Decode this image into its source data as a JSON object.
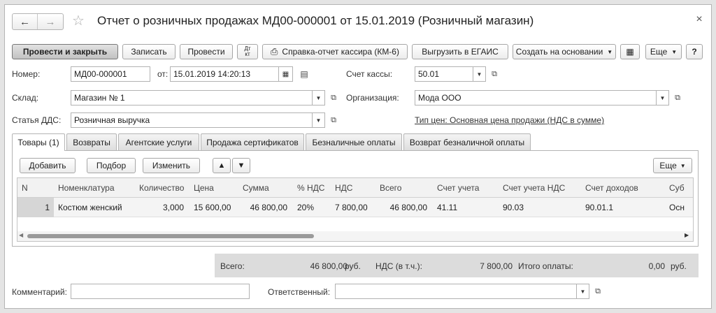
{
  "window": {
    "title": "Отчет о розничных продажах МД00-000001 от 15.01.2019 (Розничный магазин)",
    "close_icon": "close-icon"
  },
  "nav": {
    "back_icon": "arrow-left-icon",
    "forward_icon": "arrow-right-icon",
    "favorite_icon": "star-icon"
  },
  "toolbar": {
    "post_and_close": "Провести и закрыть",
    "save": "Записать",
    "post": "Провести",
    "dt_kt_top": "Дт",
    "dt_kt_bottom": "кт",
    "cashier_report": "Справка-отчет кассира (КМ-6)",
    "export_egais": "Выгрузить в ЕГАИС",
    "create_based_on": "Создать на основании",
    "more": "Еще",
    "help": "?"
  },
  "form": {
    "number_label": "Номер:",
    "number_value": "МД00-000001",
    "date_label": "от:",
    "date_value": "15.01.2019 14:20:13",
    "cash_account_label": "Счет кассы:",
    "cash_account_value": "50.01",
    "warehouse_label": "Склад:",
    "warehouse_value": "Магазин № 1",
    "organization_label": "Организация:",
    "organization_value": "Мода ООО",
    "dds_label": "Статья ДДС:",
    "dds_value": "Розничная выручка",
    "price_type_link": "Тип цен: Основная цена продажи (НДС в сумме)"
  },
  "tabs": [
    "Товары (1)",
    "Возвраты",
    "Агентские услуги",
    "Продажа сертификатов",
    "Безналичные оплаты",
    "Возврат безналичной оплаты"
  ],
  "table_toolbar": {
    "add": "Добавить",
    "select": "Подбор",
    "edit": "Изменить",
    "more": "Еще"
  },
  "table": {
    "columns": [
      "N",
      "Номенклатура",
      "Количество",
      "Цена",
      "Сумма",
      "% НДС",
      "НДС",
      "Всего",
      "Счет учета",
      "Счет учета НДС",
      "Счет доходов",
      "Суб"
    ],
    "rows": [
      [
        "1",
        "Костюм женский",
        "3,000",
        "15 600,00",
        "46 800,00",
        "20%",
        "7 800,00",
        "46 800,00",
        "41.11",
        "90.03",
        "90.01.1",
        "Осн"
      ]
    ]
  },
  "totals": {
    "total_label": "Всего:",
    "total_value": "46 800,00",
    "currency1": "руб.",
    "vat_label": "НДС (в т.ч.):",
    "vat_value": "7 800,00",
    "payment_label": "Итого оплаты:",
    "payment_value": "0,00",
    "currency2": "руб."
  },
  "footer": {
    "comment_label": "Комментарий:",
    "comment_value": "",
    "responsible_label": "Ответственный:",
    "responsible_value": ""
  }
}
